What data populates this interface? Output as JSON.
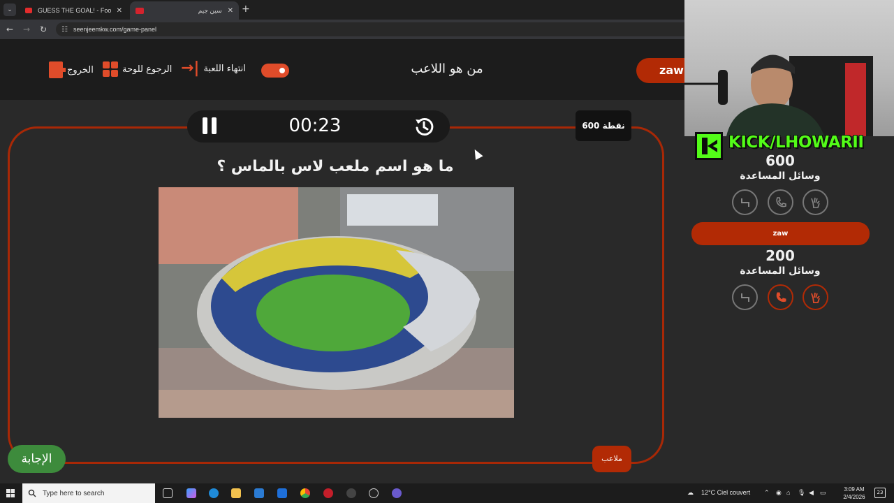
{
  "browser": {
    "tabs": [
      {
        "title": "GUESS THE GOAL! - Football q",
        "active": false
      },
      {
        "title": "سين جيم",
        "active": true
      }
    ],
    "url": "seenjeemkw.com/game-panel"
  },
  "game": {
    "controls": {
      "exit_label": "الخروج",
      "back_to_board_label": "الرجوع للوحة",
      "end_game_label": "انتهاء اللعبة"
    },
    "title": "من هو اللاعب",
    "current_team": "zaw",
    "timer": {
      "time": "00:23"
    },
    "points_label": "600 نقطة",
    "question": "ما هو اسم ملعب لاس بالماس ؟",
    "image_description_icon": "stadium-photo",
    "category_label": "ملاعب",
    "answer_button_label": "الإجابة",
    "accent_color": "#b22a05",
    "answer_color": "#3d8b3c"
  },
  "overlay": {
    "kick_text": "KICK/LHOWARII",
    "team1": {
      "score": "600",
      "aids_label": "وسائل المساعدة"
    },
    "team2": {
      "name": "zaw",
      "score": "200",
      "aids_label": "وسائل المساعدة"
    }
  },
  "taskbar": {
    "search_placeholder": "Type here to search",
    "weather": "12°C  Ciel couvert",
    "time": "3:09 AM",
    "date": "2/4/2026",
    "notifications": "23"
  }
}
